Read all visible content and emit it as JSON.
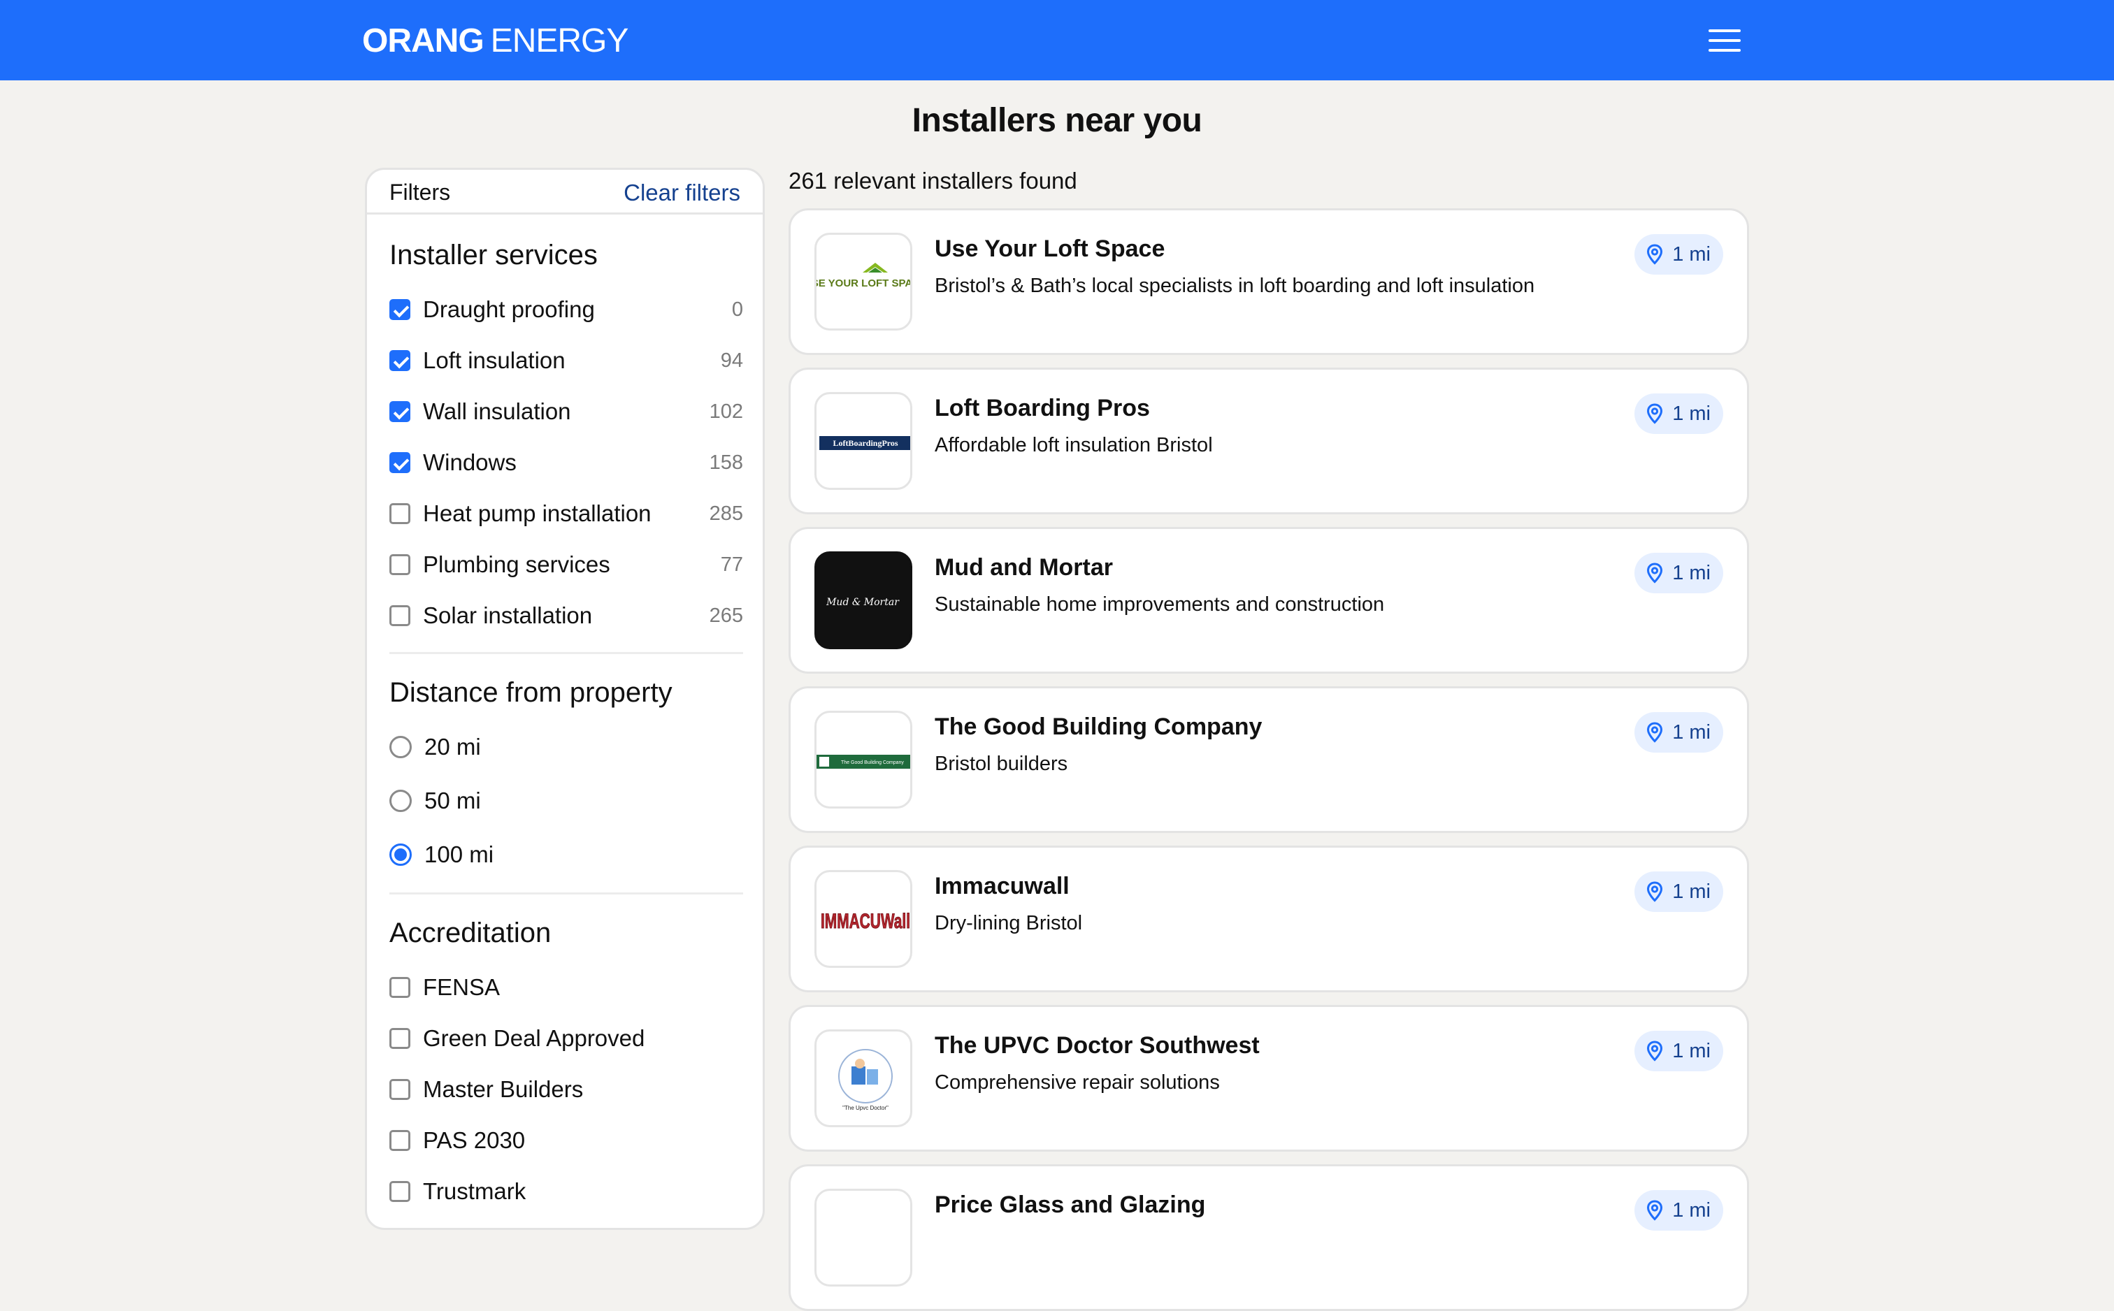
{
  "brand": {
    "bold": "ORANG",
    "light": "ENERGY"
  },
  "page_title": "Installers near you",
  "filters": {
    "title": "Filters",
    "clear_label": "Clear filters",
    "services": {
      "title": "Installer services",
      "items": [
        {
          "label": "Draught proofing",
          "count": "0",
          "checked": true
        },
        {
          "label": "Loft insulation",
          "count": "94",
          "checked": true
        },
        {
          "label": "Wall insulation",
          "count": "102",
          "checked": true
        },
        {
          "label": "Windows",
          "count": "158",
          "checked": true
        },
        {
          "label": "Heat pump installation",
          "count": "285",
          "checked": false
        },
        {
          "label": "Plumbing services",
          "count": "77",
          "checked": false
        },
        {
          "label": "Solar installation",
          "count": "265",
          "checked": false
        }
      ]
    },
    "distance": {
      "title": "Distance from property",
      "options": [
        {
          "label": "20 mi",
          "selected": false
        },
        {
          "label": "50 mi",
          "selected": false
        },
        {
          "label": "100 mi",
          "selected": true
        }
      ]
    },
    "accreditation": {
      "title": "Accreditation",
      "items": [
        {
          "label": "FENSA",
          "checked": false
        },
        {
          "label": "Green Deal Approved",
          "checked": false
        },
        {
          "label": "Master Builders",
          "checked": false
        },
        {
          "label": "PAS 2030",
          "checked": false
        },
        {
          "label": "Trustmark",
          "checked": false
        }
      ]
    }
  },
  "results": {
    "count_text": "261 relevant installers found",
    "installers": [
      {
        "name": "Use Your Loft Space",
        "description": "Bristol’s & Bath’s local specialists in loft boarding and loft insulation",
        "distance": "1 mi",
        "logo_text": "USE YOUR LOFT SPACE"
      },
      {
        "name": "Loft Boarding Pros",
        "description": "Affordable loft insulation Bristol",
        "distance": "1 mi",
        "logo_text": "LoftBoardingPros"
      },
      {
        "name": "Mud and Mortar",
        "description": "Sustainable home improvements and construction",
        "distance": "1 mi",
        "logo_text": "Mud & Mortar"
      },
      {
        "name": "The Good Building Company",
        "description": "Bristol builders",
        "distance": "1 mi",
        "logo_text": "The Good Building Company"
      },
      {
        "name": "Immacuwall",
        "description": "Dry-lining Bristol",
        "distance": "1 mi",
        "logo_text": "IMMACUWall"
      },
      {
        "name": "The UPVC Doctor Southwest",
        "description": "Comprehensive repair solutions",
        "distance": "1 mi",
        "logo_text": "\"The Upvc Doctor\""
      },
      {
        "name": "Price Glass and Glazing",
        "description": "",
        "distance": "1 mi",
        "logo_text": ""
      }
    ]
  },
  "colors": {
    "brand_blue": "#1e6efb",
    "link_blue": "#15418f",
    "badge_bg": "#e6efff"
  },
  "icons": {
    "menu": "hamburger-menu-icon",
    "location": "location-pin-icon"
  }
}
